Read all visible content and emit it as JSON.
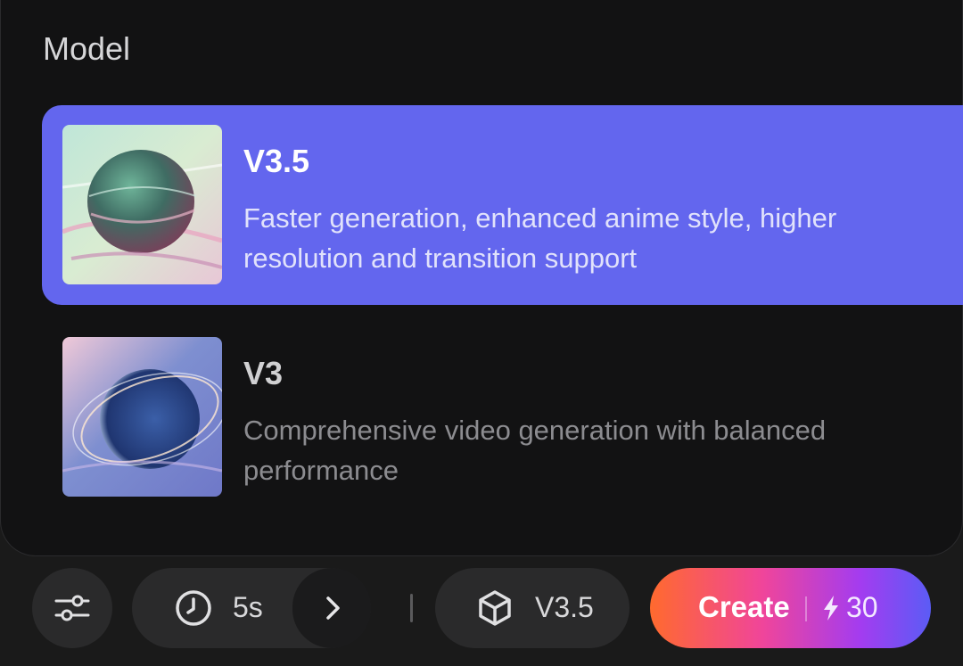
{
  "panel": {
    "title": "Model"
  },
  "models": [
    {
      "name": "V3.5",
      "description": "Faster generation, enhanced anime style, higher resolution and transition support",
      "selected": true
    },
    {
      "name": "V3",
      "description": "Comprehensive video generation with balanced performance",
      "selected": false
    }
  ],
  "toolbar": {
    "duration": "5s",
    "model": "V3.5",
    "create_label": "Create",
    "credit_cost": "30"
  },
  "colors": {
    "selected_card": "#6366ee",
    "panel_bg": "#121213",
    "create_gradient": [
      "#ff6a2e",
      "#f0459a",
      "#a33cf0",
      "#5b5cf5"
    ]
  },
  "icons": {
    "settings": "sliders-icon",
    "duration": "clock-icon",
    "more": "chevron-right-icon",
    "model": "cube-icon",
    "cost": "lightning-icon"
  }
}
